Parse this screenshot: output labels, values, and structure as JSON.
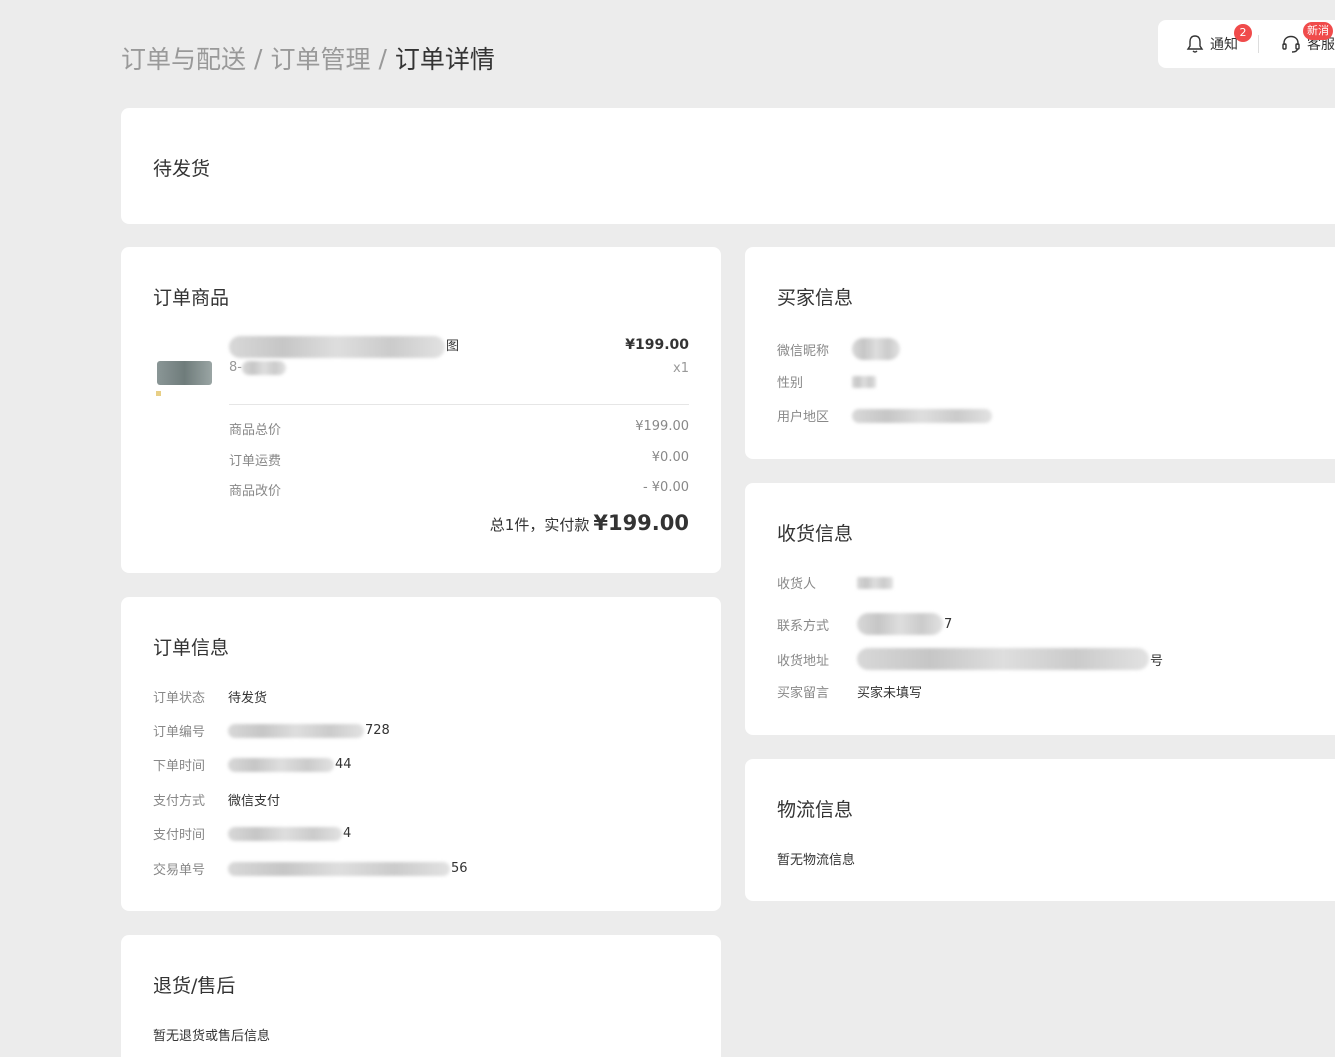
{
  "breadcrumb": {
    "level1": "订单与配送",
    "level2": "订单管理",
    "current": "订单详情",
    "separator": "/"
  },
  "topbar": {
    "notify_label": "通知",
    "notify_count": "2",
    "service_label": "客服",
    "service_badge": "新消"
  },
  "status": {
    "text": "待发货"
  },
  "goods": {
    "title": "订单商品",
    "name_suffix": "图",
    "sku_prefix": "8-",
    "price": "¥199.00",
    "qty": "x1",
    "rows": [
      {
        "label": "商品总价",
        "value": "¥199.00"
      },
      {
        "label": "订单运费",
        "value": "¥0.00"
      },
      {
        "label": "商品改价",
        "value": "- ¥0.00"
      }
    ],
    "total_label": "总1件，实付款",
    "total_amount": "¥199.00"
  },
  "order_info": {
    "title": "订单信息",
    "rows": [
      {
        "label": "订单状态",
        "value": "待发货"
      },
      {
        "label": "订单编号",
        "value": "728"
      },
      {
        "label": "下单时间",
        "value": "44"
      },
      {
        "label": "支付方式",
        "value": "微信支付"
      },
      {
        "label": "支付时间",
        "value": "4"
      },
      {
        "label": "交易单号",
        "value": "56"
      }
    ]
  },
  "refund": {
    "title": "退货/售后",
    "empty": "暂无退货或售后信息"
  },
  "buyer": {
    "title": "买家信息",
    "rows": [
      {
        "label": "微信昵称",
        "value": ""
      },
      {
        "label": "性别",
        "value": ""
      },
      {
        "label": "用户地区",
        "value": ""
      }
    ]
  },
  "receiver": {
    "title": "收货信息",
    "rows": [
      {
        "label": "收货人",
        "value": ""
      },
      {
        "label": "联系方式",
        "value": "7"
      },
      {
        "label": "收货地址",
        "value": "号"
      },
      {
        "label": "买家留言",
        "value": "买家未填写"
      }
    ]
  },
  "logistics": {
    "title": "物流信息",
    "empty": "暂无物流信息"
  }
}
